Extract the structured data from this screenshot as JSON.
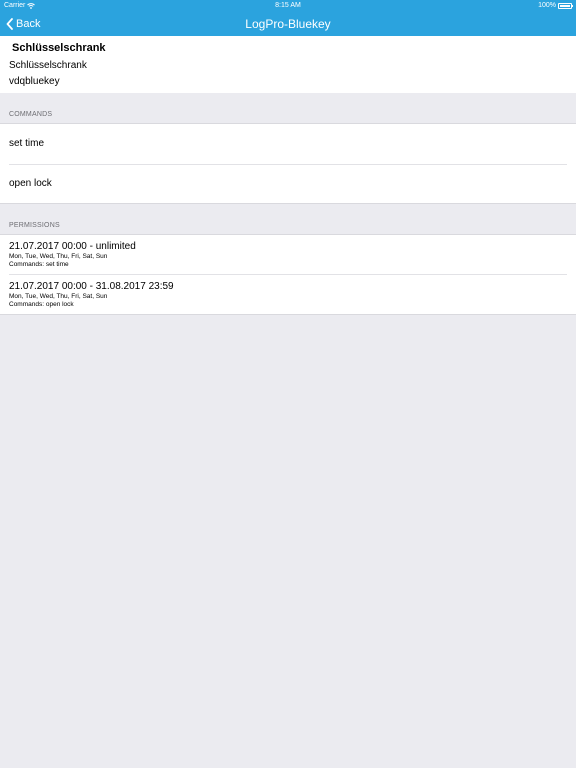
{
  "status_bar": {
    "carrier": "Carrier",
    "time": "8:15 AM",
    "battery": "100%",
    "battery_level": 1.0
  },
  "nav": {
    "back_label": "Back",
    "title": "LogPro-Bluekey"
  },
  "device": {
    "title": "Schlüsselschrank",
    "name": "Schlüsselschrank",
    "id": "vdqbluekey"
  },
  "commands": {
    "header": "COMMANDS",
    "items": [
      {
        "label": "set time"
      },
      {
        "label": "open lock"
      }
    ]
  },
  "permissions": {
    "header": "PERMISSIONS",
    "items": [
      {
        "range": "21.07.2017 00:00 - unlimited",
        "days": "Mon, Tue, Wed, Thu, Fri, Sat, Sun",
        "commands": "Commands: set time"
      },
      {
        "range": "21.07.2017 00:00 - 31.08.2017 23:59",
        "days": "Mon, Tue, Wed, Thu, Fri, Sat, Sun",
        "commands": "Commands: open lock"
      }
    ]
  },
  "colors": {
    "accent": "#2ba3de",
    "background": "#ebebf0"
  }
}
